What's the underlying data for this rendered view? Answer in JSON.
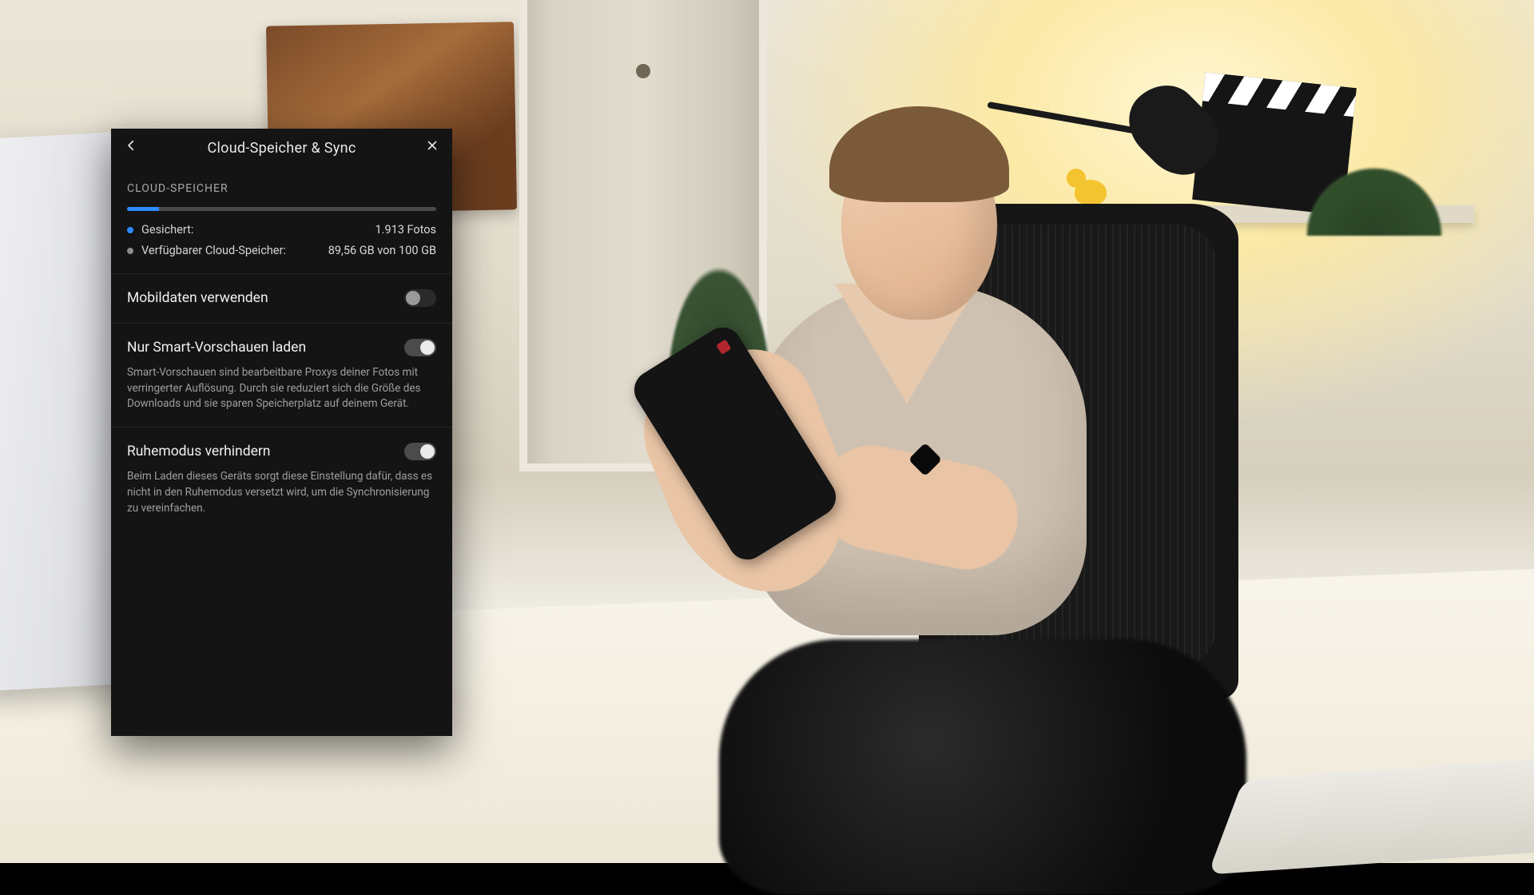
{
  "panel": {
    "title": "Cloud-Speicher & Sync",
    "section_label": "CLOUD-SPEICHER",
    "storage": {
      "used_percent": 10.4,
      "backed_up": {
        "label": "Gesichert:",
        "value": "1.913 Fotos"
      },
      "available": {
        "label": "Verfügbarer Cloud-Speicher:",
        "value": "89,56 GB von 100 GB"
      }
    },
    "settings": {
      "mobile_data": {
        "label": "Mobildaten verwenden",
        "on": false
      },
      "smart_previews": {
        "label": "Nur Smart-Vorschauen laden",
        "on": true,
        "description": "Smart-Vorschauen sind bearbeitbare Proxys deiner Fotos mit verringerter Auflösung. Durch sie reduziert sich die Größe des Downloads und sie sparen Speicherplatz auf deinem Gerät."
      },
      "prevent_sleep": {
        "label": "Ruhemodus verhindern",
        "on": true,
        "description": "Beim Laden dieses Geräts sorgt diese Einstellung dafür, dass es nicht in den Ruhemodus versetzt wird, um die Synchronisierung zu vereinfachen."
      }
    }
  },
  "colors": {
    "accent_blue": "#2e8bff"
  }
}
